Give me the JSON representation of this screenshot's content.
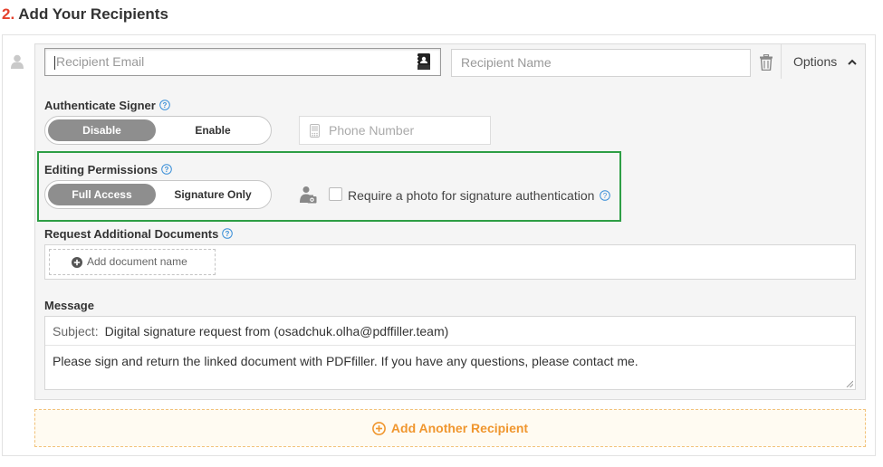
{
  "section": {
    "number": "2.",
    "title": "Add Your Recipients"
  },
  "recipient": {
    "email_placeholder": "Recipient Email",
    "name_placeholder": "Recipient Name",
    "options_label": "Options"
  },
  "authenticate": {
    "label": "Authenticate Signer",
    "options": [
      "Disable",
      "Enable"
    ],
    "selected": "Disable",
    "phone_placeholder": "Phone Number"
  },
  "permissions": {
    "label": "Editing Permissions",
    "options": [
      "Full Access",
      "Signature Only"
    ],
    "selected": "Full Access",
    "photo_checkbox_label": "Require a photo for signature authentication",
    "photo_checkbox_checked": false
  },
  "documents": {
    "label": "Request Additional Documents",
    "add_label": "Add document name"
  },
  "message": {
    "label": "Message",
    "subject_label": "Subject:",
    "subject_value": "Digital signature request from  (osadchuk.olha@pdffiller.team)",
    "body": "Please sign and return the linked document with PDFfiller. If you have any questions, please contact me."
  },
  "add_recipient_label": "Add Another Recipient",
  "colors": {
    "accent_red": "#e5412d",
    "highlight_green": "#2e9e45",
    "orange": "#f0962e",
    "help_blue": "#3a8fd8",
    "toggle_active": "#8e8e8e"
  }
}
